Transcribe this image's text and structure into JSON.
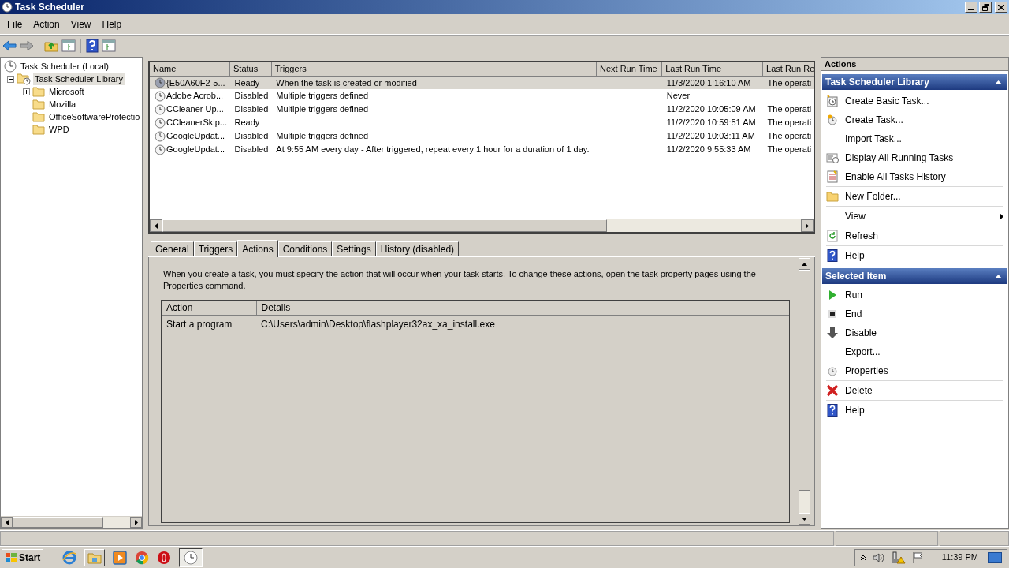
{
  "window": {
    "title": "Task Scheduler"
  },
  "menu": [
    "File",
    "Action",
    "View",
    "Help"
  ],
  "tree": [
    {
      "label": "Task Scheduler (Local)",
      "kind": "root",
      "selected": false,
      "children": [
        {
          "label": "Task Scheduler Library",
          "kind": "branch",
          "expanded": true,
          "selected": true,
          "children": [
            {
              "label": "Microsoft",
              "kind": "branch",
              "expanded": false,
              "selected": false
            },
            {
              "label": "Mozilla",
              "kind": "leaf",
              "selected": false
            },
            {
              "label": "OfficeSoftwareProtectio",
              "kind": "leaf",
              "selected": false
            },
            {
              "label": "WPD",
              "kind": "leaf",
              "selected": false
            }
          ]
        }
      ]
    }
  ],
  "tasks": {
    "columns": [
      "Name",
      "Status",
      "Triggers",
      "Next Run Time",
      "Last Run Time",
      "Last Run Re"
    ],
    "rows": [
      {
        "name": "{E50A60F2-5...",
        "status": "Ready",
        "triggers": "When the task is created or modified",
        "last_run": "11/3/2020 1:16:10 AM",
        "last_result": "The operati",
        "selected": true
      },
      {
        "name": "Adobe Acrob...",
        "status": "Disabled",
        "triggers": "Multiple triggers defined",
        "last_run": "Never",
        "selected": false
      },
      {
        "name": "CCleaner Up...",
        "status": "Disabled",
        "triggers": "Multiple triggers defined",
        "last_run": "11/2/2020 10:05:09 AM",
        "last_result": "The operati",
        "selected": false
      },
      {
        "name": "CCleanerSkip...",
        "status": "Ready",
        "last_run": "11/2/2020 10:59:51 AM",
        "last_result": "The operati",
        "selected": false
      },
      {
        "name": "GoogleUpdat...",
        "status": "Disabled",
        "triggers": "Multiple triggers defined",
        "last_run": "11/2/2020 10:03:11 AM",
        "last_result": "The operati",
        "selected": false
      },
      {
        "name": "GoogleUpdat...",
        "status": "Disabled",
        "triggers": "At 9:55 AM every day - After triggered, repeat every 1 hour for a duration of 1 day.",
        "last_run": "11/2/2020 9:55:33 AM",
        "last_result": "The operati",
        "selected": false
      }
    ]
  },
  "tabs": [
    {
      "label": "General",
      "selected": false
    },
    {
      "label": "Triggers",
      "selected": false
    },
    {
      "label": "Actions",
      "selected": true
    },
    {
      "label": "Conditions",
      "selected": false
    },
    {
      "label": "Settings",
      "selected": false
    },
    {
      "label": "History (disabled)",
      "selected": false
    }
  ],
  "actions_tab": {
    "description": "When you create a task, you must specify the action that will occur when your task starts.  To change these actions, open the task property pages using the Properties command.",
    "columns": [
      "Action",
      "Details"
    ],
    "rows": [
      {
        "action": "Start a program",
        "details": "C:\\Users\\admin\\Desktop\\flashplayer32ax_xa_install.exe"
      }
    ]
  },
  "actions_pane": {
    "header": "Actions",
    "sections": [
      {
        "title": "Task Scheduler Library",
        "groups": [
          [
            {
              "label": "Create Basic Task...",
              "submenu": false
            },
            {
              "label": "Create Task...",
              "submenu": false
            },
            {
              "label": "Import Task...",
              "submenu": false
            },
            {
              "label": "Display All Running Tasks",
              "submenu": false
            },
            {
              "label": "Enable All Tasks History",
              "submenu": false
            }
          ],
          [
            {
              "label": "New Folder...",
              "submenu": false
            }
          ],
          [
            {
              "label": "View",
              "submenu": true
            }
          ],
          [
            {
              "label": "Refresh",
              "submenu": false
            }
          ],
          [
            {
              "label": "Help",
              "submenu": false
            }
          ]
        ]
      },
      {
        "title": "Selected Item",
        "groups": [
          [
            {
              "label": "Run",
              "submenu": false
            },
            {
              "label": "End",
              "submenu": false
            },
            {
              "label": "Disable",
              "submenu": false
            },
            {
              "label": "Export...",
              "submenu": false
            },
            {
              "label": "Properties",
              "submenu": false
            }
          ],
          [
            {
              "label": "Delete",
              "submenu": false
            }
          ],
          [
            {
              "label": "Help",
              "submenu": false
            }
          ]
        ]
      }
    ]
  },
  "taskbar": {
    "start": "Start",
    "clock": "11:39 PM"
  }
}
